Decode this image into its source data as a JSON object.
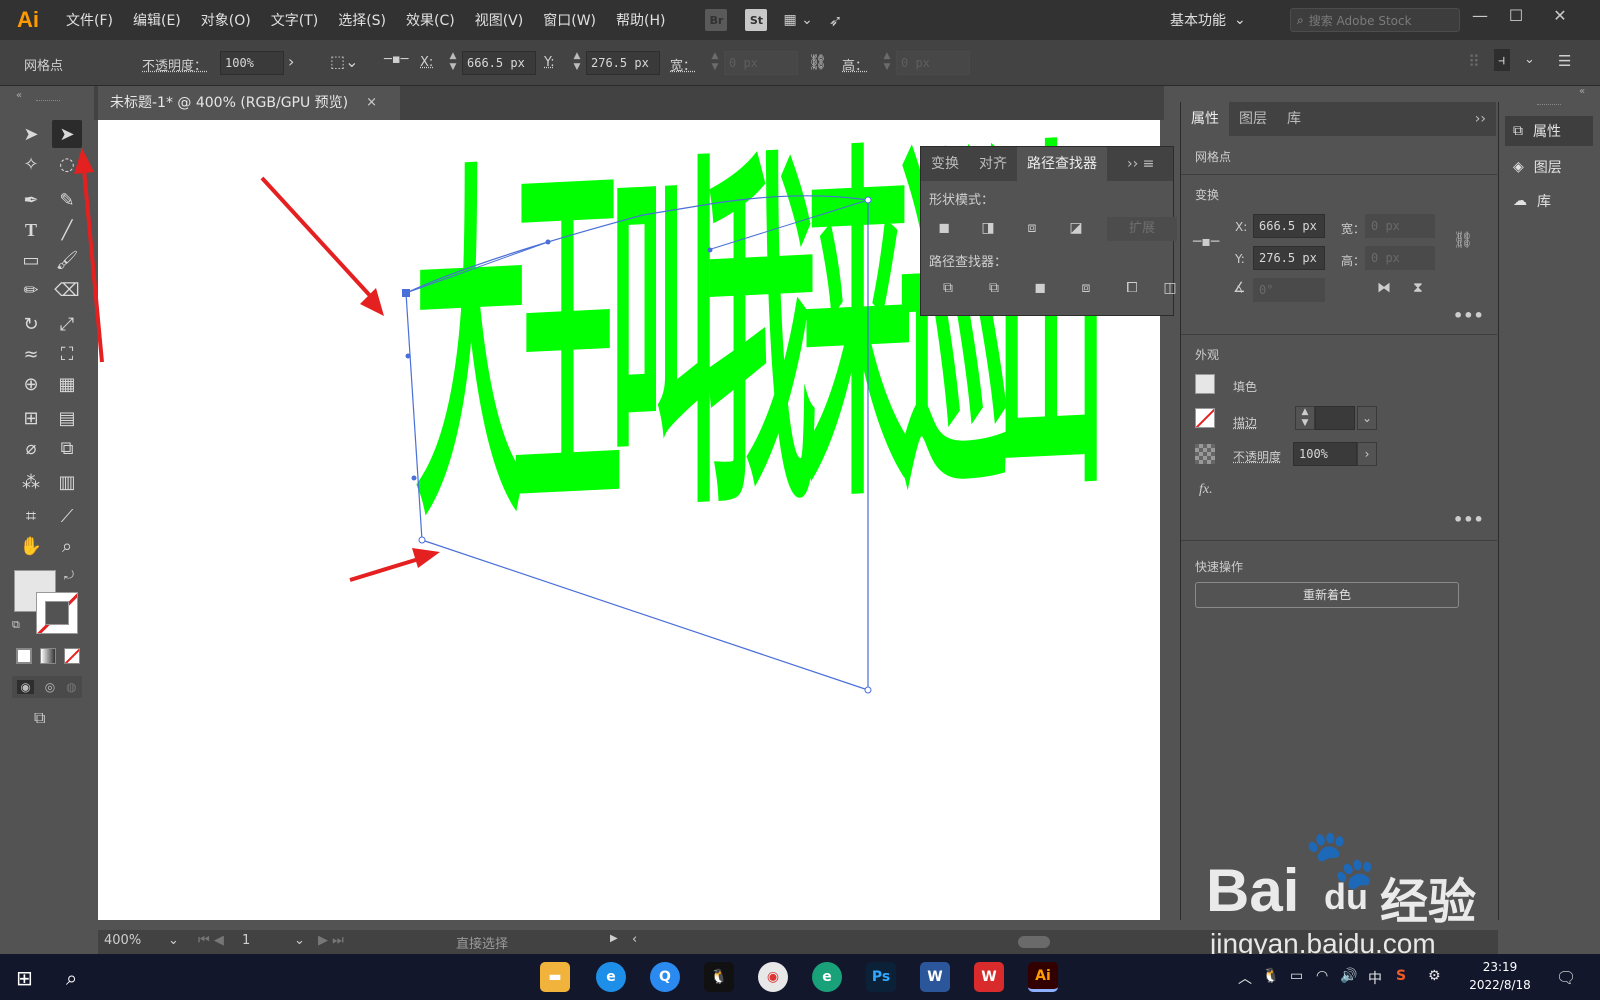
{
  "app": {
    "logo": "Ai",
    "menu": [
      "文件(F)",
      "编辑(E)",
      "对象(O)",
      "文字(T)",
      "选择(S)",
      "效果(C)",
      "视图(V)",
      "窗口(W)",
      "帮助(H)"
    ],
    "bridge_icon": "Br",
    "stock_icon": "St",
    "workspace": "基本功能",
    "search_placeholder": "搜索 Adobe Stock"
  },
  "control_bar": {
    "selection_type": "网格点",
    "opacity_label": "不透明度：",
    "opacity_value": "100%",
    "x_label": "X:",
    "x_value": "666.5 px",
    "y_label": "Y:",
    "y_value": "276.5 px",
    "w_label": "宽：",
    "w_value": "0 px",
    "h_label": "高：",
    "h_value": "0 px"
  },
  "document": {
    "tab_title": "未标题-1* @ 400% (RGB/GPU 预览)",
    "close": "×",
    "artwork_text": "大王叫我来巡山",
    "artwork_color": "#00ff00"
  },
  "pathfinder": {
    "tabs": [
      "变换",
      "对齐",
      "路径查找器"
    ],
    "shape_modes_label": "形状模式：",
    "expand_label": "扩展",
    "pathfinders_label": "路径查找器："
  },
  "properties": {
    "tabs": [
      "属性",
      "图层",
      "库"
    ],
    "selection_type": "网格点",
    "transform_title": "变换",
    "x_label": "X:",
    "x_value": "666.5 px",
    "y_label": "Y:",
    "y_value": "276.5 px",
    "w_label": "宽：",
    "w_value": "0 px",
    "h_label": "高：",
    "h_value": "0 px",
    "angle_value": "0°",
    "appearance_title": "外观",
    "fill_label": "填色",
    "stroke_label": "描边",
    "opacity_label": "不透明度",
    "opacity_value": "100%",
    "fx_label": "fx.",
    "quick_actions_title": "快速操作",
    "recolor_button": "重新着色"
  },
  "dock": {
    "items": [
      "属性",
      "图层",
      "库"
    ]
  },
  "status_bar": {
    "zoom": "400%",
    "artboard": "1",
    "tool_name": "直接选择"
  },
  "taskbar": {
    "time": "23:19",
    "date": "2022/8/18",
    "ime": "中"
  },
  "watermark": {
    "brand": "Bai",
    "brand_du": "du",
    "brand_cn": "经验",
    "url": "jingyan.baidu.com"
  },
  "colors": {
    "accent_selection": "#4a6fd8",
    "arrow_red": "#e52020",
    "artwork_green": "#00ff00"
  }
}
